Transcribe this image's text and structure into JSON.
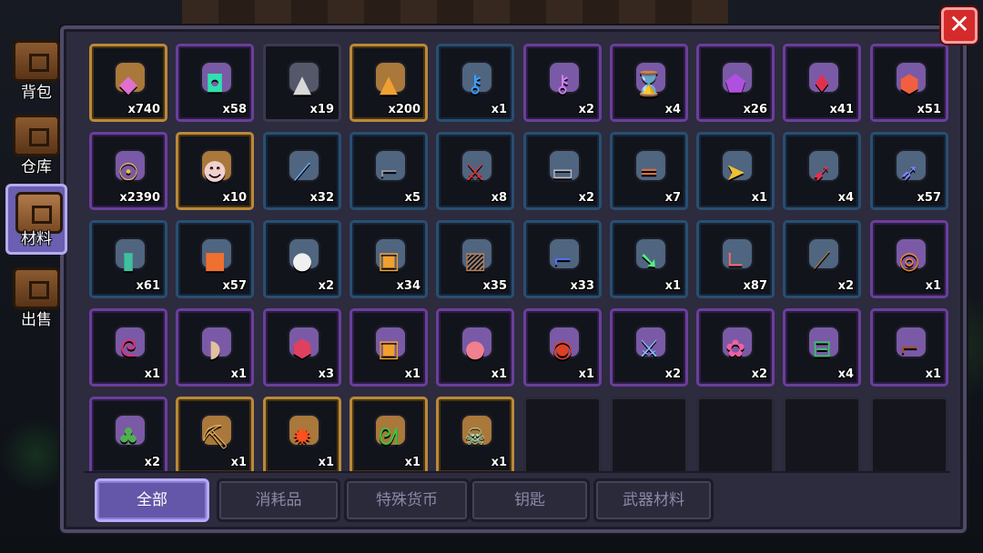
{
  "window": {
    "close_label": "✕"
  },
  "side_tabs": [
    {
      "label": "背包",
      "active": false
    },
    {
      "label": "仓库",
      "active": false
    },
    {
      "label": "材料",
      "active": true
    },
    {
      "label": "出售",
      "active": false
    }
  ],
  "filter_tabs": [
    {
      "label": "全部",
      "active": true
    },
    {
      "label": "消耗品",
      "active": false
    },
    {
      "label": "特殊货币",
      "active": false
    },
    {
      "label": "钥匙",
      "active": false
    },
    {
      "label": "武器材料",
      "active": false
    }
  ],
  "items": [
    {
      "rarity": "gold",
      "icon": "pink-gem",
      "glyph": "◆",
      "color": "#e070d0",
      "count": "x740"
    },
    {
      "rarity": "purple",
      "icon": "green-gem",
      "glyph": "◘",
      "color": "#30e0b0",
      "count": "x58"
    },
    {
      "rarity": "",
      "icon": "silver-ore",
      "glyph": "▲",
      "color": "#d8d8d8",
      "count": "x19"
    },
    {
      "rarity": "gold",
      "icon": "gold-ore",
      "glyph": "▲",
      "color": "#f0a030",
      "count": "x200"
    },
    {
      "rarity": "blue",
      "icon": "blue-key-crystal",
      "glyph": "⚷",
      "color": "#3aa0ff",
      "count": "x1"
    },
    {
      "rarity": "purple",
      "icon": "purple-key-crystal",
      "glyph": "⚷",
      "color": "#d080f0",
      "count": "x2"
    },
    {
      "rarity": "purple",
      "icon": "hourglass-coin",
      "glyph": "⌛",
      "color": "#e0c080",
      "count": "x4"
    },
    {
      "rarity": "purple",
      "icon": "purple-token",
      "glyph": "⬟",
      "color": "#b050e0",
      "count": "x26"
    },
    {
      "rarity": "purple",
      "icon": "red-crystal",
      "glyph": "♦",
      "color": "#e03050",
      "count": "x41"
    },
    {
      "rarity": "purple",
      "icon": "orange-rune",
      "glyph": "⬢",
      "color": "#f06040",
      "count": "x51"
    },
    {
      "rarity": "purple",
      "icon": "gold-medal",
      "glyph": "☉",
      "color": "#f0c030",
      "count": "x2390"
    },
    {
      "rarity": "gold",
      "icon": "skull-egg",
      "glyph": "☻",
      "color": "#f0d0d0",
      "count": "x10"
    },
    {
      "rarity": "blue",
      "icon": "spear-part",
      "glyph": "⟋",
      "color": "#70b0ff",
      "count": "x32"
    },
    {
      "rarity": "blue",
      "icon": "pistol-part",
      "glyph": "⌐",
      "color": "#9090a0",
      "count": "x5"
    },
    {
      "rarity": "blue",
      "icon": "red-blade",
      "glyph": "⚔",
      "color": "#e03030",
      "count": "x8"
    },
    {
      "rarity": "blue",
      "icon": "cylinder-part",
      "glyph": "▭",
      "color": "#c0c0c0",
      "count": "x2"
    },
    {
      "rarity": "blue",
      "icon": "rifle-part",
      "glyph": "═",
      "color": "#d07040",
      "count": "x7"
    },
    {
      "rarity": "blue",
      "icon": "bullet-part",
      "glyph": "➤",
      "color": "#f0c030",
      "count": "x1"
    },
    {
      "rarity": "blue",
      "icon": "drill-part",
      "glyph": "➹",
      "color": "#e03050",
      "count": "x4"
    },
    {
      "rarity": "blue",
      "icon": "fish-blade",
      "glyph": "➶",
      "color": "#8080ff",
      "count": "x57"
    },
    {
      "rarity": "blue",
      "icon": "magazine-part",
      "glyph": "▮",
      "color": "#40c0a0",
      "count": "x61"
    },
    {
      "rarity": "blue",
      "icon": "orange-block",
      "glyph": "■",
      "color": "#f07030",
      "count": "x57"
    },
    {
      "rarity": "blue",
      "icon": "white-blob",
      "glyph": "●",
      "color": "#f0f0f0",
      "count": "x2"
    },
    {
      "rarity": "blue",
      "icon": "lantern-part",
      "glyph": "▣",
      "color": "#f0a030",
      "count": "x34"
    },
    {
      "rarity": "blue",
      "icon": "metal-plate",
      "glyph": "▨",
      "color": "#b08060",
      "count": "x35"
    },
    {
      "rarity": "blue",
      "icon": "blue-gun-part",
      "glyph": "⌐",
      "color": "#5070ff",
      "count": "x33"
    },
    {
      "rarity": "blue",
      "icon": "green-crystal-blade",
      "glyph": "➘",
      "color": "#50f080",
      "count": "x1"
    },
    {
      "rarity": "blue",
      "icon": "boomerang-part",
      "glyph": "∟",
      "color": "#f07070",
      "count": "x87"
    },
    {
      "rarity": "blue",
      "icon": "wood-stock",
      "glyph": "⟋",
      "color": "#a07040",
      "count": "x2"
    },
    {
      "rarity": "purple",
      "icon": "orange-ring",
      "glyph": "◎",
      "color": "#f08030",
      "count": "x1"
    },
    {
      "rarity": "purple",
      "icon": "whip-part",
      "glyph": "ᘓ",
      "color": "#e03070",
      "count": "x1"
    },
    {
      "rarity": "purple",
      "icon": "horn-part",
      "glyph": "◗",
      "color": "#e0c0a0",
      "count": "x1"
    },
    {
      "rarity": "purple",
      "icon": "shield-part",
      "glyph": "⬢",
      "color": "#e04060",
      "count": "x3"
    },
    {
      "rarity": "purple",
      "icon": "lantern-core",
      "glyph": "▣",
      "color": "#f0a030",
      "count": "x1"
    },
    {
      "rarity": "purple",
      "icon": "pink-orb",
      "glyph": "●",
      "color": "#f08090",
      "count": "x1"
    },
    {
      "rarity": "purple",
      "icon": "red-orb-disc",
      "glyph": "◉",
      "color": "#e04020",
      "count": "x1"
    },
    {
      "rarity": "purple",
      "icon": "ice-sword",
      "glyph": "⚔",
      "color": "#80c0ff",
      "count": "x2"
    },
    {
      "rarity": "purple",
      "icon": "pink-flower",
      "glyph": "✿",
      "color": "#f060a0",
      "count": "x2"
    },
    {
      "rarity": "purple",
      "icon": "green-gun",
      "glyph": "⊟",
      "color": "#40c070",
      "count": "x4"
    },
    {
      "rarity": "purple",
      "icon": "brown-crossbow",
      "glyph": "⌐",
      "color": "#a05030",
      "count": "x1"
    },
    {
      "rarity": "purple",
      "icon": "cactus-pot",
      "glyph": "♣",
      "color": "#50b050",
      "count": "x2"
    },
    {
      "rarity": "gold",
      "icon": "pickaxe",
      "glyph": "⛏",
      "color": "#e0b060",
      "count": "x1"
    },
    {
      "rarity": "gold",
      "icon": "fire-sun-tile",
      "glyph": "✹",
      "color": "#ff5020",
      "count": "x1"
    },
    {
      "rarity": "gold",
      "icon": "green-dragon",
      "glyph": "ᘛ",
      "color": "#40c040",
      "count": "x1"
    },
    {
      "rarity": "gold",
      "icon": "fish-skeleton",
      "glyph": "☠",
      "color": "#a0e0c0",
      "count": "x1"
    },
    {
      "rarity": "empty",
      "icon": "",
      "glyph": "",
      "color": "",
      "count": ""
    },
    {
      "rarity": "empty",
      "icon": "",
      "glyph": "",
      "color": "",
      "count": ""
    },
    {
      "rarity": "empty",
      "icon": "",
      "glyph": "",
      "color": "",
      "count": ""
    },
    {
      "rarity": "empty",
      "icon": "",
      "glyph": "",
      "color": "",
      "count": ""
    },
    {
      "rarity": "empty",
      "icon": "",
      "glyph": "",
      "color": "",
      "count": ""
    }
  ]
}
